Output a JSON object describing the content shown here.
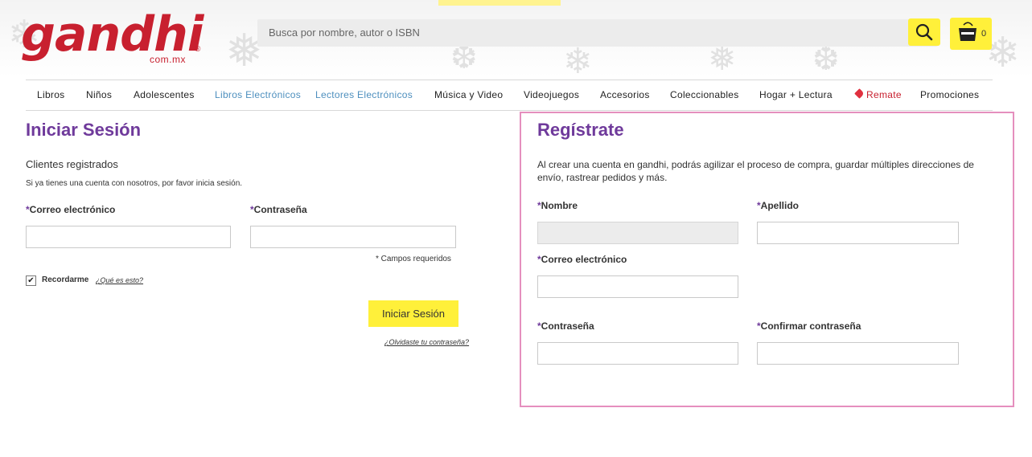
{
  "header": {
    "logo": {
      "word": "gandhi",
      "domain": "com.mx",
      "reg": "®"
    },
    "search": {
      "placeholder": "Busca por nombre, autor o ISBN",
      "icon": "search-icon"
    },
    "cart": {
      "count": "0",
      "icon": "shopping-bag-icon"
    }
  },
  "nav": {
    "items": [
      {
        "label": "Libros"
      },
      {
        "label": "Niños"
      },
      {
        "label": "Adolescentes"
      },
      {
        "label": "Libros Electrónicos"
      },
      {
        "label": "Lectores Electrónicos"
      },
      {
        "label": "Música y Video"
      },
      {
        "label": "Videojuegos"
      },
      {
        "label": "Accesorios"
      },
      {
        "label": "Coleccionables"
      },
      {
        "label": "Hogar + Lectura"
      },
      {
        "label": "Remate"
      },
      {
        "label": "Promociones"
      }
    ]
  },
  "login": {
    "title": "Iniciar Sesión",
    "subtitle": "Clientes registrados",
    "description": "Si ya tienes una cuenta con nosotros, por favor inicia sesión.",
    "email_label": "Correo electrónico",
    "password_label": "Contraseña",
    "required_note": "* Campos requeridos",
    "remember_label": "Recordarme",
    "remember_checked": true,
    "what_is_this": "¿Qué es esto?",
    "submit_label": "Iniciar Sesión",
    "forgot_link": "¿Olvidaste tu contraseña?"
  },
  "register": {
    "title": "Regístrate",
    "description": "Al crear una cuenta en gandhi, podrás agilizar el proceso de compra, guardar múltiples direcciones de envío, rastrear pedidos y más.",
    "first_name_label": "Nombre",
    "last_name_label": "Apellido",
    "email_label": "Correo electrónico",
    "password_label": "Contraseña",
    "confirm_password_label": "Confirmar contraseña"
  },
  "colors": {
    "brand_red": "#c8202f",
    "accent_purple": "#6f3a9b",
    "accent_yellow": "#fff03a",
    "link_blue": "#4d8fbe",
    "highlight_pink": "#e58fbe"
  }
}
